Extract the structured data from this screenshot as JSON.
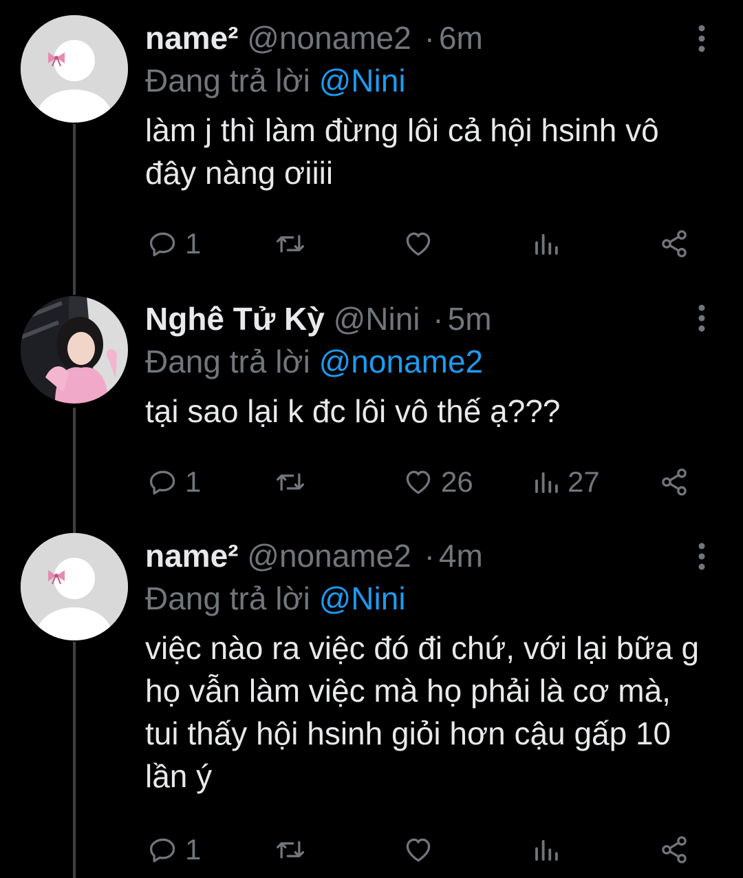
{
  "tweets": [
    {
      "name": "name²",
      "handle": "@noname2",
      "separator": "·",
      "time": "6m",
      "reply_prefix": "Đang trả lời",
      "reply_to": "@Nini",
      "text": "làm j thì làm đừng lôi cả hội hsinh vô đây nàng ơiiii",
      "reply_count": "1",
      "retweet_count": "",
      "like_count": "",
      "view_count": ""
    },
    {
      "name": "Nghê Tử Kỳ",
      "handle": "@Nini",
      "separator": "·",
      "time": "5m",
      "reply_prefix": "Đang trả lời",
      "reply_to": "@noname2",
      "text": "tại sao lại k đc lôi vô thế ạ???",
      "reply_count": "1",
      "retweet_count": "",
      "like_count": "26",
      "view_count": "27"
    },
    {
      "name": "name²",
      "handle": "@noname2",
      "separator": "·",
      "time": "4m",
      "reply_prefix": "Đang trả lời",
      "reply_to": "@Nini",
      "text": "việc nào ra việc đó đi chứ, với lại bữa g họ vẫn làm việc mà họ phải là cơ mà, tui thấy hội hsinh giỏi hơn cậu gấp 10 lần ý",
      "reply_count": "1",
      "retweet_count": "",
      "like_count": "",
      "view_count": ""
    }
  ],
  "colors": {
    "background": "#000000",
    "text": "#e7e9ea",
    "muted": "#71767b",
    "mention": "#1d9bf0",
    "thread_line": "#3e4144"
  },
  "icons": {
    "reply": "reply-icon",
    "retweet": "retweet-icon",
    "like": "heart-icon",
    "views": "views-icon",
    "share": "share-icon",
    "more": "more-vertical-icon",
    "avatar_bow": "bow-icon"
  }
}
